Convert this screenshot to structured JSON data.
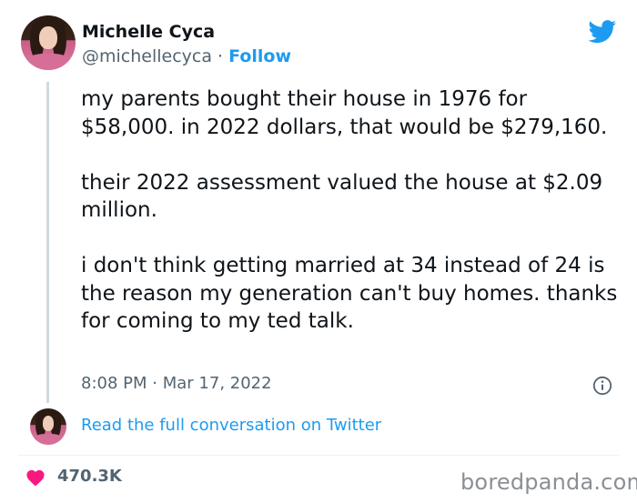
{
  "author": {
    "name": "Michelle Cyca",
    "handle": "@michellecyca",
    "separator": "·",
    "follow_label": "Follow"
  },
  "tweet": {
    "paragraphs": [
      "my parents bought their house in 1976 for $58,000. in 2022 dollars, that would be $279,160.",
      "their 2022 assessment valued the house at $2.09 million.",
      "i don't think getting married at 34 instead of 24 is the reason my generation can't buy homes. thanks for coming to my ted talk."
    ],
    "time": "8:08 PM",
    "date_separator": "·",
    "date": "Mar 17, 2022"
  },
  "conversation_link": "Read the full conversation on Twitter",
  "likes": "470.3K",
  "watermark": "boredpanda.com",
  "icons": {
    "brand": "twitter-bird-icon",
    "info": "info-icon",
    "like": "heart-icon"
  },
  "colors": {
    "accent": "#1d9bf0",
    "heart": "#f91880",
    "muted": "#536471",
    "text": "#0f1419"
  }
}
